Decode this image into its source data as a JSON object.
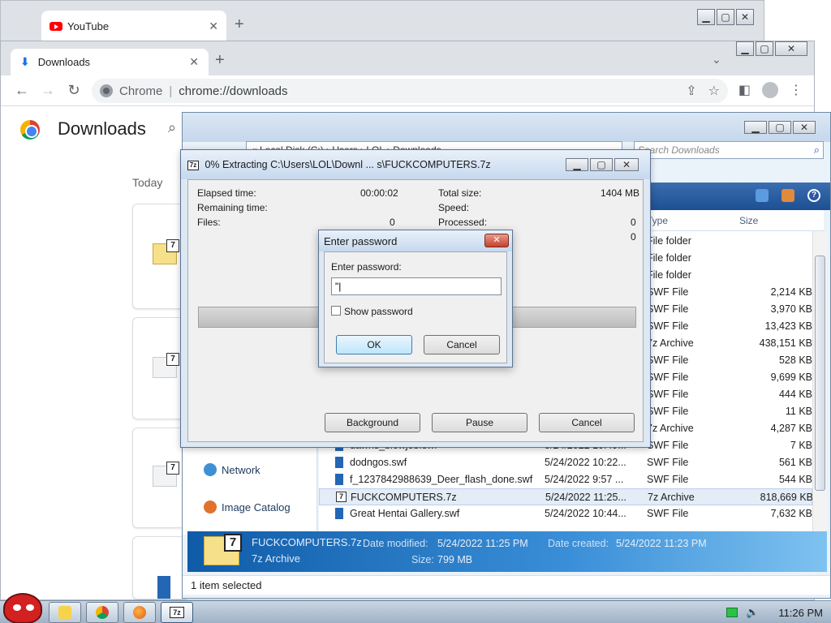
{
  "back_window": {
    "tab_title": "YouTube"
  },
  "chrome": {
    "tab_title": "Downloads",
    "omnibox_label": "Chrome",
    "omnibox_url": "chrome://downloads",
    "page_title": "Downloads",
    "section_label": "Today"
  },
  "explorer": {
    "address": "« Local Disk (C:) › Users › LOL › Downloads",
    "search_placeholder": "Search Downloads",
    "columns": {
      "type": "Type",
      "size": "Size"
    },
    "nav": [
      {
        "label": "Network"
      },
      {
        "label": "Image Catalog"
      }
    ],
    "files": [
      {
        "name": "",
        "date": "",
        "type": "File folder",
        "size": ""
      },
      {
        "name": "",
        "date": "",
        "type": "File folder",
        "size": ""
      },
      {
        "name": "",
        "date": "",
        "type": "File folder",
        "size": ""
      },
      {
        "name": "",
        "date": "",
        "type": "SWF File",
        "size": "2,214 KB"
      },
      {
        "name": "",
        "date": "",
        "type": "SWF File",
        "size": "3,970 KB"
      },
      {
        "name": "",
        "date": "",
        "type": "SWF File",
        "size": "13,423 KB"
      },
      {
        "name": "",
        "date": "",
        "type": "7z Archive",
        "size": "438,151 KB"
      },
      {
        "name": "",
        "date": "",
        "type": "SWF File",
        "size": "528 KB"
      },
      {
        "name": "",
        "date": "",
        "type": "SWF File",
        "size": "9,699 KB"
      },
      {
        "name": "",
        "date": "",
        "type": "SWF File",
        "size": "444 KB"
      },
      {
        "name": "",
        "date": "",
        "type": "SWF File",
        "size": "11 KB"
      },
      {
        "name": "",
        "date": "",
        "type": "7z Archive",
        "size": "4,287 KB"
      },
      {
        "name": "dawns_blowjob.swf",
        "date": "5/24/2022 10:49...",
        "type": "SWF File",
        "size": "7 KB"
      },
      {
        "name": "dodngos.swf",
        "date": "5/24/2022 10:22...",
        "type": "SWF File",
        "size": "561 KB"
      },
      {
        "name": "f_1237842988639_Deer_flash_done.swf",
        "date": "5/24/2022 9:57 ...",
        "type": "SWF File",
        "size": "544 KB"
      },
      {
        "name": "FUCKCOMPUTERS.7z",
        "date": "5/24/2022 11:25...",
        "type": "7z Archive",
        "size": "818,669 KB"
      },
      {
        "name": "Great Hentai Gallery.swf",
        "date": "5/24/2022 10:44...",
        "type": "SWF File",
        "size": "7,632 KB"
      }
    ],
    "details": {
      "filename": "FUCKCOMPUTERS.7z",
      "filetype": "7z Archive",
      "date_modified_label": "Date modified:",
      "date_modified": "5/24/2022 11:25 PM",
      "date_created_label": "Date created:",
      "date_created": "5/24/2022 11:23 PM",
      "size_label": "Size:",
      "size": "799 MB"
    },
    "status": "1 item selected"
  },
  "zip_dialog": {
    "title": "0% Extracting C:\\Users\\LOL\\Downl ... s\\FUCKCOMPUTERS.7z",
    "elapsed_label": "Elapsed time:",
    "elapsed_value": "00:00:02",
    "remaining_label": "Remaining time:",
    "files_label": "Files:",
    "files_value": "0",
    "total_label": "Total size:",
    "total_value": "1404 MB",
    "speed_label": "Speed:",
    "processed_label": "Processed:",
    "processed_value": "0",
    "extra_value": "0",
    "progress": 0,
    "buttons": {
      "background": "Background",
      "pause": "Pause",
      "cancel": "Cancel"
    }
  },
  "password_dialog": {
    "title": "Enter password",
    "label": "Enter password:",
    "value": "\"|",
    "show_password": "Show password",
    "ok": "OK",
    "cancel": "Cancel"
  },
  "taskbar": {
    "time": "11:26 PM"
  }
}
